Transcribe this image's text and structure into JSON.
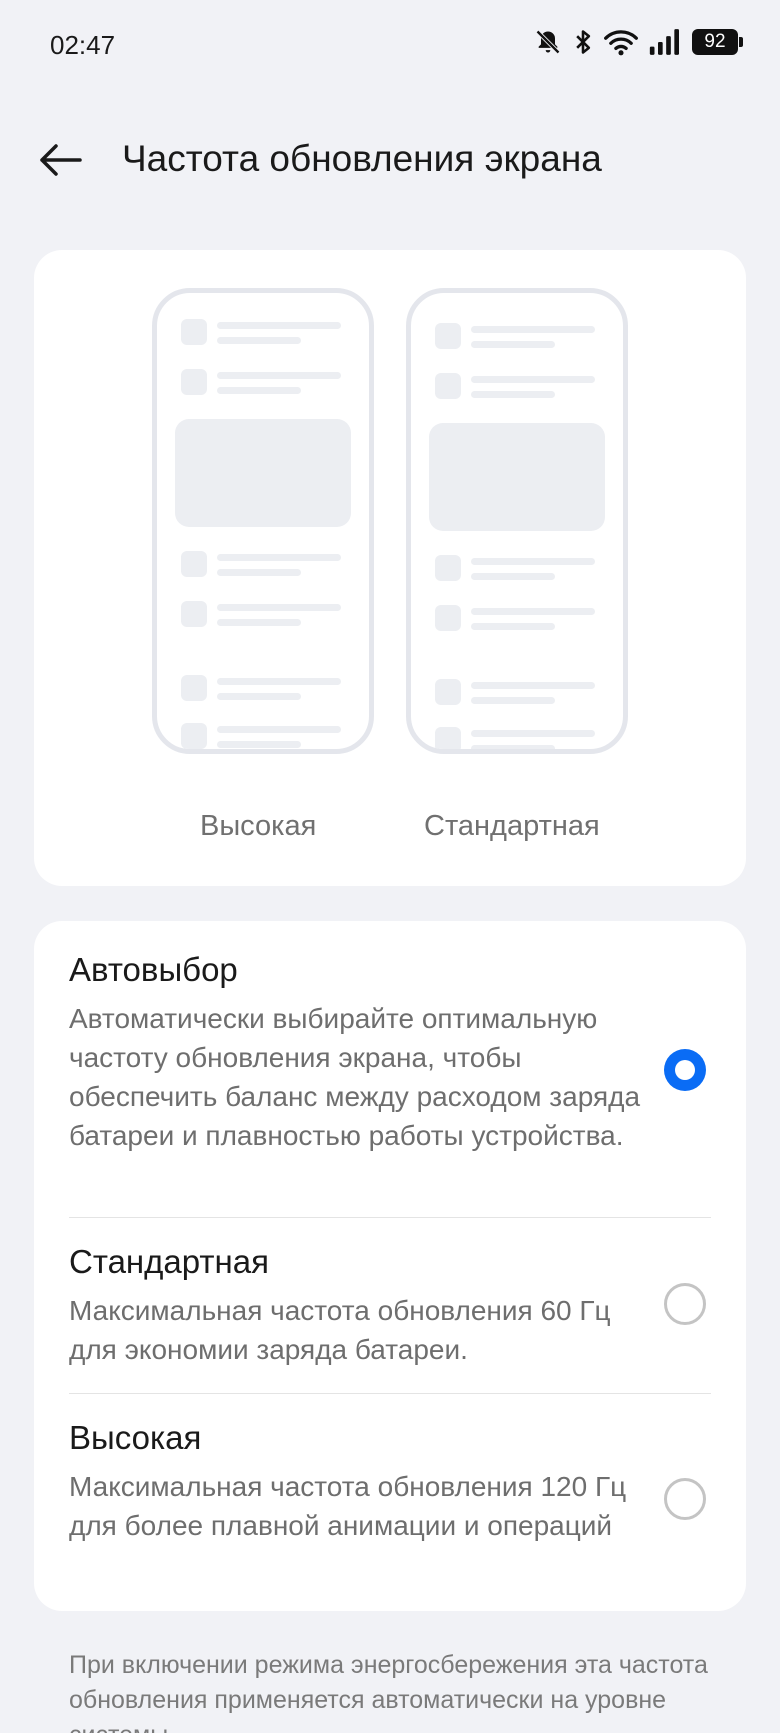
{
  "status_bar": {
    "time": "02:47",
    "battery": "92",
    "icons": [
      "bell-off-icon",
      "bluetooth-icon",
      "wifi-icon",
      "signal-icon",
      "battery-icon"
    ]
  },
  "header": {
    "title": "Частота обновления экрана",
    "back_icon": "back-arrow-icon"
  },
  "preview": {
    "high_label": "Высокая",
    "standard_label": "Стандартная"
  },
  "options": [
    {
      "title": "Автовыбор",
      "description": "Автоматически выбирайте оптимальную частоту обновления экрана, чтобы обеспечить баланс между расходом заряда батареи и плавностью работы устройства.",
      "selected": true
    },
    {
      "title": "Стандартная",
      "description": "Максимальная частота обновления 60 Гц для экономии заряда батареи.",
      "selected": false
    },
    {
      "title": "Высокая",
      "description": "Максимальная частота обновления 120 Гц для более плавной анимации и операций",
      "selected": false
    }
  ],
  "footnote": "При включении режима энергосбережения эта частота обновления применяется автоматически на уровне системы.",
  "colors": {
    "background": "#f1f2f6",
    "card": "#ffffff",
    "accent": "#0a6cf5",
    "text_primary": "#1a1a1a",
    "text_secondary": "#6e6e6e"
  }
}
